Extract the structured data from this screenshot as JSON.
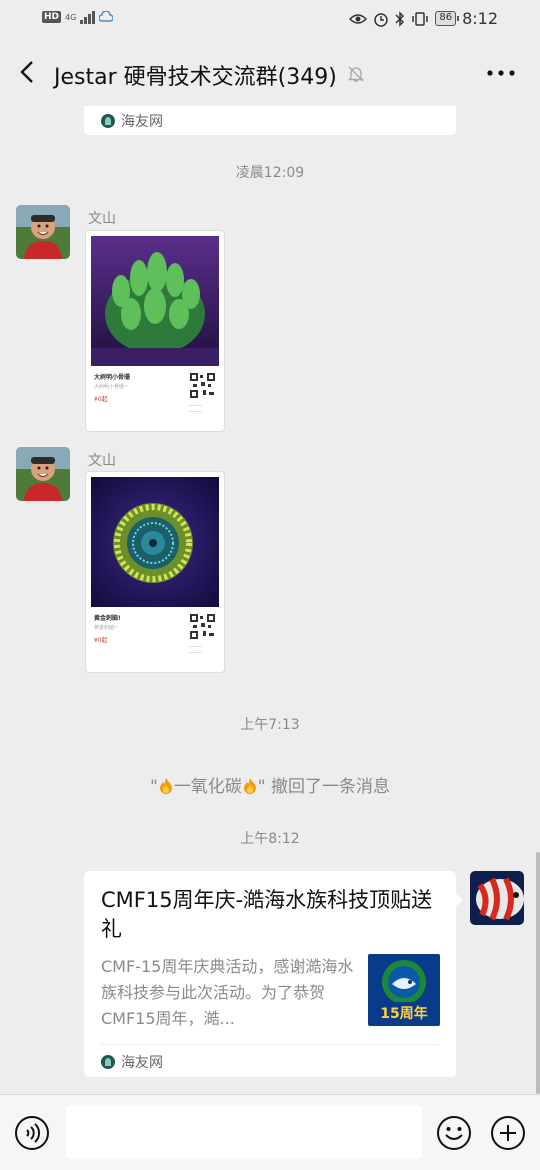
{
  "status_bar": {
    "hd": "HD",
    "network": "4G",
    "battery": "86",
    "time": "8:12"
  },
  "header": {
    "title": "Jestar 硬骨技术交流群(349)"
  },
  "chat": {
    "prev_card_source": "海友网",
    "timestamps": [
      "凌晨12:09",
      "上午7:13",
      "上午8:12"
    ],
    "messages": [
      {
        "sender": "文山",
        "type": "image",
        "product_title": "大树明小骨珊",
        "product_subtitle": "大树明小骨珊~",
        "product_price": "¥0起"
      },
      {
        "sender": "文山",
        "type": "image",
        "product_title": "黄金刺脑!",
        "product_subtitle": "黄金刺脑~",
        "product_price": "¥0起"
      }
    ],
    "recall_notice": {
      "name": "一氧化碳",
      "open_quote": "\"",
      "text": "\" 撤回了一条消息"
    },
    "link_card": {
      "title": "CMF15周年庆-澔海水族科技顶贴送礼",
      "description": "CMF-15周年庆典活动，感谢澔海水族科技参与此次活动。为了恭贺CMF15周年，澔...",
      "thumb_text": "15周年",
      "source": "海友网"
    }
  },
  "colors": {
    "background": "#ededed",
    "bubble": "#ffffff",
    "muted_text": "#8a8a8a",
    "price": "#c0392b"
  },
  "icons": [
    "back-arrow-icon",
    "mute-bell-icon",
    "more-dots-icon",
    "voice-icon",
    "emoji-icon",
    "plus-icon",
    "fire-icon"
  ]
}
